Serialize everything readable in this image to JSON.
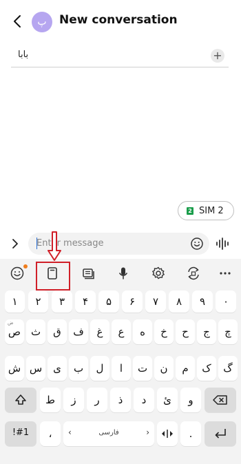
{
  "header": {
    "title": "New conversation",
    "avatar_letter": "پ"
  },
  "recipient": {
    "value": "بابا",
    "add_label": "+"
  },
  "sim": {
    "badge": "2",
    "label": "SIM 2"
  },
  "compose": {
    "placeholder": "Enter message"
  },
  "keyboard": {
    "number_row": [
      "۱",
      "۲",
      "۳",
      "۴",
      "۵",
      "۶",
      "۷",
      "۸",
      "۹",
      "۰"
    ],
    "row1": [
      "ص",
      "ث",
      "ق",
      "ف",
      "غ",
      "ع",
      "ه",
      "خ",
      "ح",
      "ج",
      "چ"
    ],
    "row2": [
      "ش",
      "س",
      "ی",
      "ب",
      "ل",
      "ا",
      "ت",
      "ن",
      "م",
      "ک",
      "گ"
    ],
    "row3": [
      "ط",
      "ز",
      "ر",
      "ذ",
      "د",
      "ئ",
      "و"
    ],
    "sym_label": "!#1",
    "comma": "،",
    "space_label": "فارسی",
    "period": "."
  }
}
